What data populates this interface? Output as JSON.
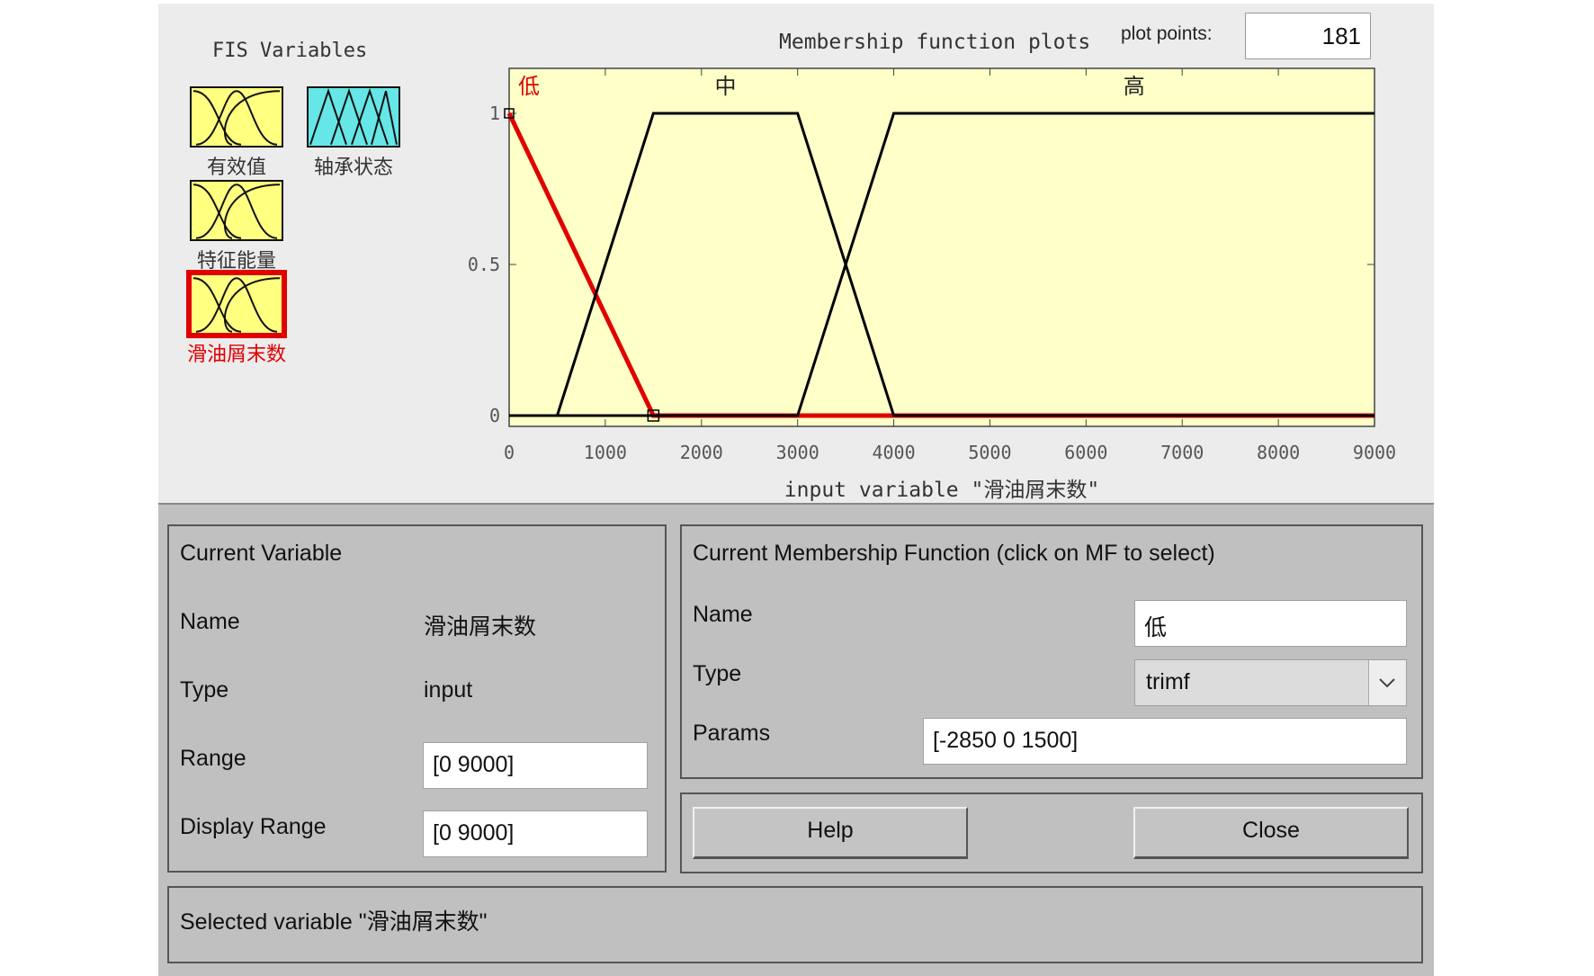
{
  "fis_variables": {
    "title": "FIS Variables",
    "items": [
      {
        "label": "有效值",
        "color": "#ffff80",
        "kind": "input"
      },
      {
        "label": "轴承状态",
        "color": "#66e6e6",
        "kind": "output"
      },
      {
        "label": "特征能量",
        "color": "#ffff80",
        "kind": "input"
      },
      {
        "label": "滑油屑末数",
        "color": "#ffff80",
        "kind": "input",
        "selected": true
      }
    ]
  },
  "plot": {
    "title": "Membership function plots",
    "plot_points_label": "plot points:",
    "plot_points_value": "181"
  },
  "chart_data": {
    "type": "line",
    "xlabel": "input variable \"滑油屑末数\"",
    "xlim": [
      0,
      9000
    ],
    "ylim": [
      0,
      1
    ],
    "x_ticks": [
      "0",
      "1000",
      "2000",
      "3000",
      "4000",
      "5000",
      "6000",
      "7000",
      "8000",
      "9000"
    ],
    "y_ticks": [
      "0",
      "0.5",
      "1"
    ],
    "background": "#ffffc8",
    "series": [
      {
        "name": "低",
        "type": "trimf",
        "params": [
          -2850,
          0,
          1500
        ],
        "color": "#e00000",
        "selected": true,
        "points": [
          [
            0,
            1
          ],
          [
            1500,
            0
          ],
          [
            9000,
            0
          ]
        ]
      },
      {
        "name": "中",
        "type": "trapmf",
        "color": "#000000",
        "points": [
          [
            0,
            0
          ],
          [
            500,
            0
          ],
          [
            1500,
            1
          ],
          [
            3000,
            1
          ],
          [
            4000,
            0
          ],
          [
            9000,
            0
          ]
        ]
      },
      {
        "name": "高",
        "type": "trapmf",
        "color": "#000000",
        "points": [
          [
            0,
            0
          ],
          [
            3000,
            0
          ],
          [
            4000,
            1
          ],
          [
            9000,
            1
          ]
        ]
      }
    ]
  },
  "current_variable": {
    "title": "Current Variable",
    "name_label": "Name",
    "name_value": "滑油屑末数",
    "type_label": "Type",
    "type_value": "input",
    "range_label": "Range",
    "range_value": "[0 9000]",
    "display_range_label": "Display Range",
    "display_range_value": "[0 9000]"
  },
  "current_mf": {
    "title": "Current Membership Function (click on MF to select)",
    "name_label": "Name",
    "name_value": "低",
    "type_label": "Type",
    "type_value": "trimf",
    "params_label": "Params",
    "params_value": "[-2850 0 1500]"
  },
  "buttons": {
    "help": "Help",
    "close": "Close"
  },
  "status": "Selected variable \"滑油屑末数\""
}
